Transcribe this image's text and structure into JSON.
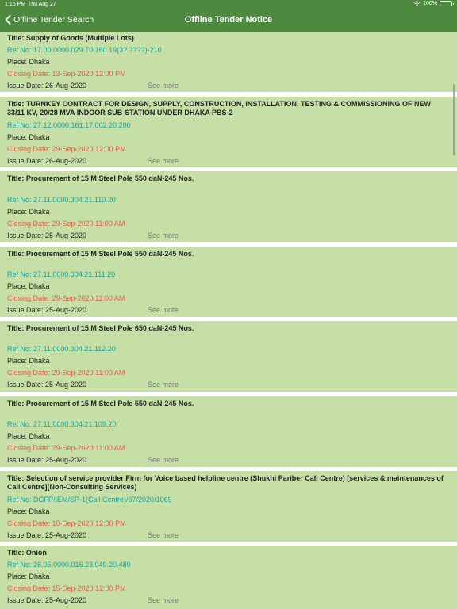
{
  "status_bar": {
    "time": "1:16 PM",
    "date": "Thu Aug 27",
    "battery": "100%"
  },
  "header": {
    "back_label": "Offline Tender Search",
    "title": "Offline Tender Notice"
  },
  "tenders": [
    {
      "title": "Title: Supply of Goods (Multiple Lots)",
      "ref": "Ref No: 17.00.0000.029.70.160.19(3? ????)-210",
      "place": "Place: Dhaka",
      "closing": "Closing Date: 13-Sep-2020 12:00 PM",
      "issue": "Issue Date: 26-Aug-2020",
      "see_more": "See more"
    },
    {
      "title": "Title: TURNKEY CONTRACT FOR DESIGN, SUPPLY, CONSTRUCTION, INSTALLATION, TESTING & COMMISSIONING OF NEW 33/11 KV, 20/28 MVA INDOOR SUB-STATION UNDER DHAKA PBS-2",
      "ref": "Ref No: 27.12.0000.161.17.002.20.200",
      "place": "Place: Dhaka",
      "closing": "Closing Date: 29-Sep-2020 12:00 PM",
      "issue": "Issue Date: 26-Aug-2020",
      "see_more": "See more"
    },
    {
      "title": "Title:  Procurement of  15 M Steel Pole 550 daN-245 Nos.",
      "ref": "Ref No: 27.11.0000.304.21.110.20",
      "place": "Place: Dhaka",
      "closing": "Closing Date: 29-Sep-2020 11:00 AM",
      "issue": "Issue Date: 25-Aug-2020",
      "see_more": "See more"
    },
    {
      "title": "Title:  Procurement of  15 M Steel Pole 550 daN-245 Nos.",
      "ref": "Ref No: 27.11.0000.304.21.111.20",
      "place": "Place: Dhaka",
      "closing": "Closing Date: 29-Sep-2020 11:00 AM",
      "issue": "Issue Date: 25-Aug-2020",
      "see_more": "See more"
    },
    {
      "title": "Title:  Procurement of  15 M Steel Pole 650 daN-245 Nos.",
      "ref": "Ref No: 27.11.0000.304.21.112.20",
      "place": "Place: Dhaka",
      "closing": "Closing Date: 29-Sep-2020 11:00 AM",
      "issue": "Issue Date: 25-Aug-2020",
      "see_more": "See more"
    },
    {
      "title": "Title:  Procurement of  15 M Steel Pole 550 daN-245 Nos.",
      "ref": "Ref No: 27.11.0000.304.21.109.20",
      "place": "Place: Dhaka",
      "closing": "Closing Date: 29-Sep-2020 11:00 AM",
      "issue": "Issue Date: 25-Aug-2020",
      "see_more": "See more"
    },
    {
      "title": "Title:  Selection of service provider Firm for Voice based helpline centre (Shukhi Pariber Call Centre) [services & maintenances of Call Centre](Non-Consulting Services)",
      "ref": "Ref No: DGFP/IEM/SP-1(Call Centre)/67/2020/1069",
      "place": "Place: Dhaka",
      "closing": "Closing Date: 10-Sep-2020 12:00 PM",
      "issue": "Issue Date: 25-Aug-2020",
      "see_more": "See more"
    },
    {
      "title": "Title: Onion",
      "ref": "Ref No: 26.05.0000.016.23.049.20.489",
      "place": "Place: Dhaka",
      "closing": "Closing Date: 15-Sep-2020 12:00 PM",
      "issue": "Issue Date: 25-Aug-2020",
      "see_more": "See more"
    }
  ]
}
